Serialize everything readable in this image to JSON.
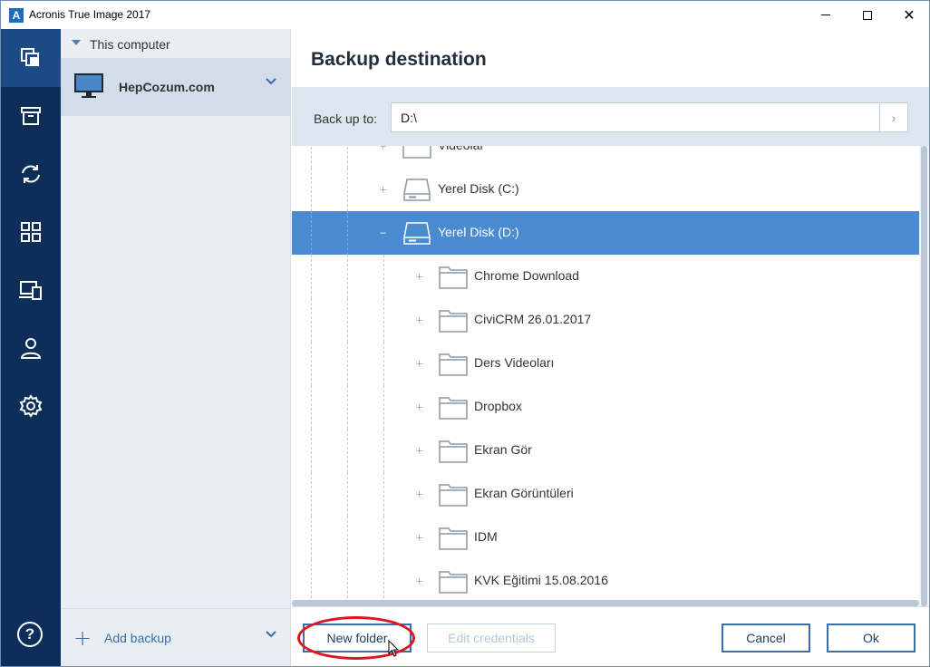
{
  "window": {
    "title": "Acronis True Image 2017",
    "logo_letter": "A",
    "close_glyph": "✕"
  },
  "navbar": {
    "items": [
      {
        "icon": "backup-icon",
        "active": true
      },
      {
        "icon": "archive-icon",
        "active": false
      },
      {
        "icon": "sync-icon",
        "active": false
      },
      {
        "icon": "dashboard-icon",
        "active": false
      },
      {
        "icon": "devices-icon",
        "active": false
      },
      {
        "icon": "account-icon",
        "active": false
      },
      {
        "icon": "settings-icon",
        "active": false
      }
    ],
    "help_glyph": "?"
  },
  "sidebar": {
    "header_label": "This computer",
    "computer_label": "HepCozum.com",
    "add_plus": "+",
    "add_label": "Add backup"
  },
  "main": {
    "title": "Backup destination",
    "dest_label": "Back up to:",
    "dest_value": "D:\\",
    "dest_go_glyph": "›",
    "tree": [
      {
        "label": "Videolar",
        "type": "folder",
        "level": 2,
        "selected": false,
        "expander": "+"
      },
      {
        "label": "Yerel Disk (C:)",
        "type": "drive",
        "level": 2,
        "selected": false,
        "expander": "+"
      },
      {
        "label": "Yerel Disk (D:)",
        "type": "drive",
        "level": 2,
        "selected": true,
        "expander": "−"
      },
      {
        "label": "Chrome Download",
        "type": "folder",
        "level": 3,
        "selected": false,
        "expander": "+"
      },
      {
        "label": "CiviCRM 26.01.2017",
        "type": "folder",
        "level": 3,
        "selected": false,
        "expander": "+"
      },
      {
        "label": "Ders Videoları",
        "type": "folder",
        "level": 3,
        "selected": false,
        "expander": "+"
      },
      {
        "label": "Dropbox",
        "type": "folder",
        "level": 3,
        "selected": false,
        "expander": "+"
      },
      {
        "label": "Ekran Gör",
        "type": "folder",
        "level": 3,
        "selected": false,
        "expander": "+"
      },
      {
        "label": "Ekran Görüntüleri",
        "type": "folder",
        "level": 3,
        "selected": false,
        "expander": "+"
      },
      {
        "label": "IDM",
        "type": "folder",
        "level": 3,
        "selected": false,
        "expander": "+"
      },
      {
        "label": "KVK Eğitimi 15.08.2016",
        "type": "folder",
        "level": 3,
        "selected": false,
        "expander": "+"
      }
    ],
    "buttons": {
      "new_folder": "New folder",
      "edit_credentials": "Edit credentials",
      "cancel": "Cancel",
      "ok": "Ok"
    }
  },
  "colors": {
    "navbar_bg": "#0e2e5a",
    "accent": "#3a6ea8",
    "selection": "#4a8ad1",
    "highlight": "#e0141e"
  }
}
